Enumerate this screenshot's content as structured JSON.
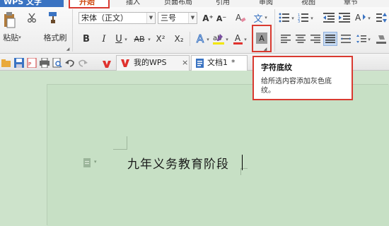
{
  "app": {
    "title": "WPS 文字"
  },
  "menu": {
    "tabs": [
      "开始",
      "插入",
      "页面布局",
      "引用",
      "审阅",
      "视图",
      "章节"
    ]
  },
  "ribbon": {
    "paste_label": "粘贴",
    "format_painter_label": "格式刷",
    "font_name": "宋体（正文）",
    "font_size": "三号",
    "bold": "B",
    "italic": "I",
    "underline": "U",
    "strikethrough": "AB",
    "superscript": "X²",
    "subscript": "X₂",
    "text_effect": "A",
    "highlight": "ab",
    "font_color": "A",
    "char_shading": "A",
    "grow_font": "A⁺",
    "shrink_font": "A⁻",
    "phonetic": "文"
  },
  "doctabs": [
    {
      "label": "我的WPS",
      "close": "×"
    },
    {
      "label": "文档1",
      "close": "*"
    }
  ],
  "document": {
    "text": "九年义务教育阶段"
  },
  "tooltip": {
    "title": "字符底纹",
    "description": "给所选内容添加灰色底纹。"
  },
  "colors": {
    "app_blue": "#3a73c2",
    "highlight_red": "#d93a30",
    "doc_green": "#cde3cb",
    "wps_red": "#e0322e"
  }
}
